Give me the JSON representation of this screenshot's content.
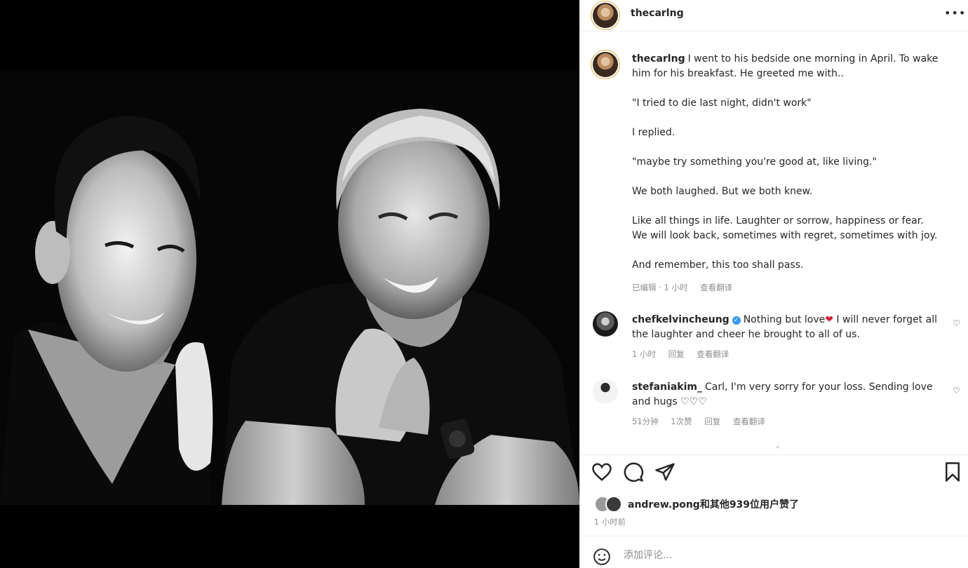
{
  "post": {
    "username": "thecarlng",
    "more_icon": "more-horizontal-icon"
  },
  "caption": {
    "username": "thecarlng",
    "first_line": "I went to his bedside one morning in April. To wake him for his breakfast. He greeted me with..",
    "lines": [
      "\"I tried to die last night, didn't work\"",
      "I replied.",
      "\"maybe try something you're good at, like living.\"",
      "We both laughed. But we both knew.",
      "Like all things in life. Laughter or sorrow, happiness or fear. We will look back, sometimes with regret, sometimes with joy.",
      "And remember, this too shall pass."
    ],
    "edited": "已编辑 · 1 小时",
    "translate": "查看翻译"
  },
  "comments": [
    {
      "username": "chefkelvincheung",
      "verified": true,
      "text_before": "Nothing but love",
      "emoji": "❤",
      "text_after": " I will never forget all the laughter and cheer he brought to all of us.",
      "time": "1 小时",
      "reply": "回复",
      "translate": "查看翻译"
    },
    {
      "username": "stefaniakim_",
      "verified": false,
      "text_before": "Carl, I'm very sorry for your loss. Sending love and hugs ",
      "emoji": "♡♡♡",
      "text_after": "",
      "time": "51分钟",
      "likes": "1次赞",
      "reply": "回复",
      "translate": "查看翻译"
    }
  ],
  "actions": {
    "icons": [
      "heart-icon",
      "comment-icon",
      "share-icon",
      "bookmark-icon"
    ]
  },
  "likes": {
    "text": "andrew.pong和其他939位用户赞了"
  },
  "timestamp": "1 小时前",
  "add_comment": {
    "placeholder": "添加评论..."
  },
  "colors": {
    "background_left": "#000000",
    "text": "#262626",
    "secondary": "#8e8e8e",
    "verified": "#3897f0",
    "heart": "#d0243c"
  }
}
